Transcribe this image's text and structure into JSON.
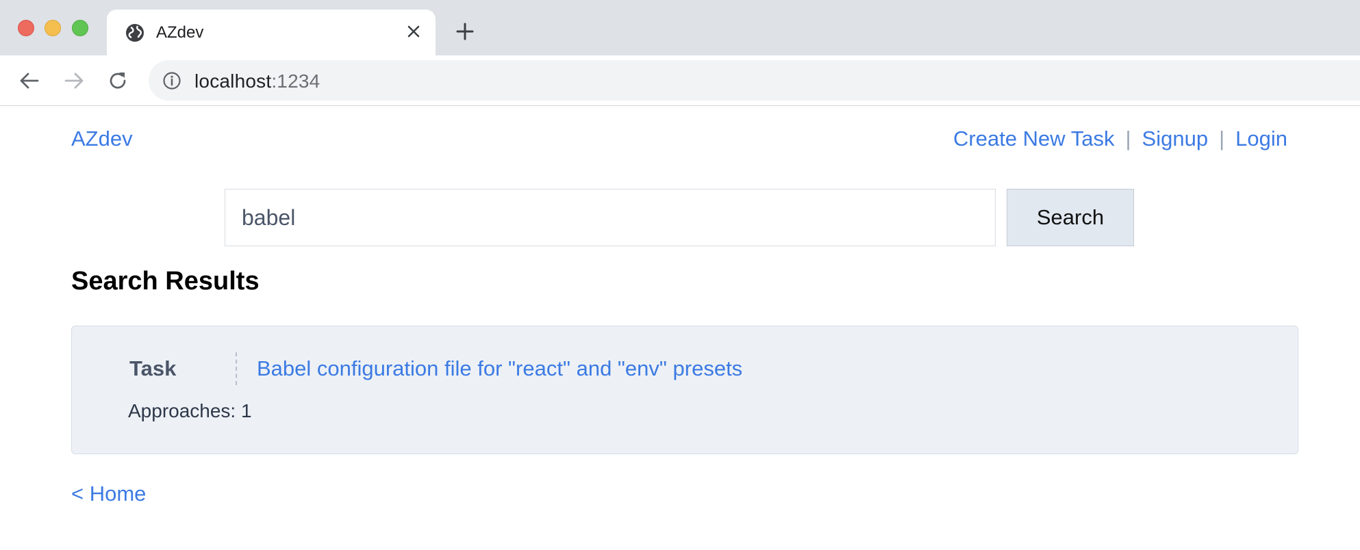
{
  "browser": {
    "tab": {
      "title": "AZdev",
      "favicon": "globe-icon",
      "close_icon": "close-icon"
    },
    "new_tab_icon": "plus-icon",
    "nav": {
      "back_icon": "arrow-left-icon",
      "forward_icon": "arrow-right-icon",
      "reload_icon": "reload-icon"
    },
    "address_bar": {
      "info_icon": "info-icon",
      "host": "localhost",
      "port": ":1234"
    }
  },
  "header": {
    "brand": "AZdev",
    "nav_links": [
      {
        "label": "Create New Task"
      },
      {
        "label": "Signup"
      },
      {
        "label": "Login"
      }
    ],
    "separator": "|"
  },
  "search": {
    "value": "babel",
    "button_label": "Search"
  },
  "results": {
    "heading": "Search Results",
    "items": [
      {
        "type": "Task",
        "title": "Babel configuration file for \"react\" and \"env\" presets",
        "meta": "Approaches: 1"
      }
    ]
  },
  "footer": {
    "home_link": "< Home"
  },
  "colors": {
    "link": "#3b7ae3",
    "card_bg": "#edf1f6",
    "button_bg": "#e2e8f0",
    "chrome_bg": "#dee1e6"
  }
}
